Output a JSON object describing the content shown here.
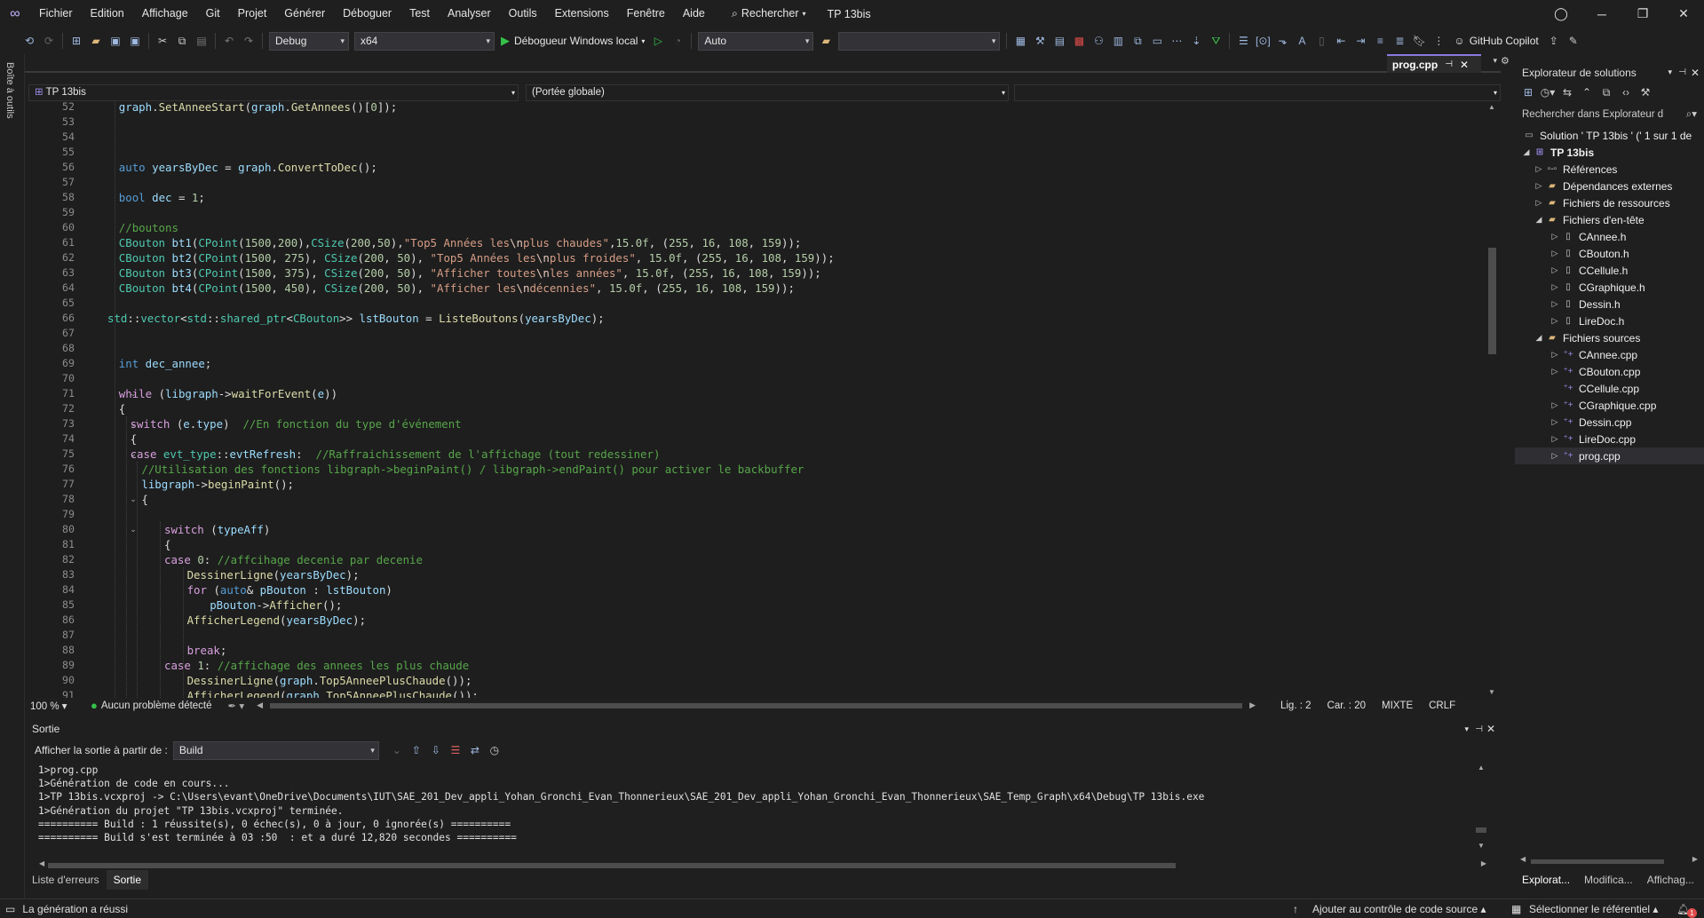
{
  "menu": [
    "Fichier",
    "Edition",
    "Affichage",
    "Git",
    "Projet",
    "Générer",
    "Déboguer",
    "Test",
    "Analyser",
    "Outils",
    "Extensions",
    "Fenêtre",
    "Aide"
  ],
  "search_label": "Rechercher",
  "solution_title": "TP 13bis",
  "toolbar": {
    "config": "Debug",
    "platform": "x64",
    "debugger": "Débogueur Windows local",
    "auto": "Auto",
    "copilot": "GitHub Copilot"
  },
  "toolbox_label": "Boîte à outils",
  "editor": {
    "tab_name": "prog.cpp",
    "nav_project": "TP 13bis",
    "nav_scope": "(Portée globale)",
    "zoom": "100 %",
    "problems": "Aucun problème détecté",
    "line": "Lig. : 2",
    "col": "Car. : 20",
    "mode": "MIXTE",
    "eol": "CRLF"
  },
  "code_lines": [
    {
      "n": "52",
      "h": "<span class=\"v\">graph</span>.<span class=\"f\">SetAnneeStart</span>(<span class=\"v\">graph</span>.<span class=\"f\">GetAnnees</span>()[<span class=\"n\">0</span>]);",
      "indent": 1
    },
    {
      "n": "53",
      "h": "",
      "indent": 0
    },
    {
      "n": "54",
      "h": "",
      "indent": 0
    },
    {
      "n": "55",
      "h": "",
      "indent": 0
    },
    {
      "n": "56",
      "h": "<span class=\"k\">auto</span> <span class=\"v\">yearsByDec</span> = <span class=\"v\">graph</span>.<span class=\"f\">ConvertToDec</span>();",
      "indent": 1
    },
    {
      "n": "57",
      "h": "",
      "indent": 0
    },
    {
      "n": "58",
      "h": "<span class=\"k\">bool</span> <span class=\"v\">dec</span> = <span class=\"n\">1</span>;",
      "indent": 1
    },
    {
      "n": "59",
      "h": "",
      "indent": 0
    },
    {
      "n": "60",
      "h": "<span class=\"c\">//boutons</span>",
      "indent": 1
    },
    {
      "n": "61",
      "h": "<span class=\"t\">CBouton</span> <span class=\"v\">bt1</span>(<span class=\"t\">CPoint</span>(<span class=\"n\">1500</span>,<span class=\"n\">200</span>),<span class=\"t\">CSize</span>(<span class=\"n\">200</span>,<span class=\"n\">50</span>),<span class=\"s\">\"Top5 Années les</span><span class=\"esc\">\\n</span><span class=\"s\">plus chaudes\"</span>,<span class=\"n\">15.0f</span>, (<span class=\"n\">255</span>, <span class=\"n\">16</span>, <span class=\"n\">108</span>, <span class=\"n\">159</span>));",
      "indent": 1
    },
    {
      "n": "62",
      "h": "<span class=\"t\">CBouton</span> <span class=\"v\">bt2</span>(<span class=\"t\">CPoint</span>(<span class=\"n\">1500</span>, <span class=\"n\">275</span>), <span class=\"t\">CSize</span>(<span class=\"n\">200</span>, <span class=\"n\">50</span>), <span class=\"s\">\"Top5 Années les</span><span class=\"esc\">\\n</span><span class=\"s\">plus froides\"</span>, <span class=\"n\">15.0f</span>, (<span class=\"n\">255</span>, <span class=\"n\">16</span>, <span class=\"n\">108</span>, <span class=\"n\">159</span>));",
      "indent": 1
    },
    {
      "n": "63",
      "h": "<span class=\"t\">CBouton</span> <span class=\"v\">bt3</span>(<span class=\"t\">CPoint</span>(<span class=\"n\">1500</span>, <span class=\"n\">375</span>), <span class=\"t\">CSize</span>(<span class=\"n\">200</span>, <span class=\"n\">50</span>), <span class=\"s\">\"Afficher toutes</span><span class=\"esc\">\\n</span><span class=\"s\">les années\"</span>, <span class=\"n\">15.0f</span>, (<span class=\"n\">255</span>, <span class=\"n\">16</span>, <span class=\"n\">108</span>, <span class=\"n\">159</span>));",
      "indent": 1
    },
    {
      "n": "64",
      "h": "<span class=\"t\">CBouton</span> <span class=\"v\">bt4</span>(<span class=\"t\">CPoint</span>(<span class=\"n\">1500</span>, <span class=\"n\">450</span>), <span class=\"t\">CSize</span>(<span class=\"n\">200</span>, <span class=\"n\">50</span>), <span class=\"s\">\"Afficher les</span><span class=\"esc\">\\n</span><span class=\"s\">décennies\"</span>, <span class=\"n\">15.0f</span>, (<span class=\"n\">255</span>, <span class=\"n\">16</span>, <span class=\"n\">108</span>, <span class=\"n\">159</span>));",
      "indent": 1
    },
    {
      "n": "65",
      "h": "",
      "indent": 0
    },
    {
      "n": "66",
      "h": "<span class=\"t\">std</span>::<span class=\"t\">vector</span>&lt;<span class=\"t\">std</span>::<span class=\"t\">shared_ptr</span>&lt;<span class=\"t\">CBouton</span>&gt;&gt; <span class=\"v\">lstBouton</span> = <span class=\"f\">ListeBoutons</span>(<span class=\"v\">yearsByDec</span>);",
      "indent": 0
    },
    {
      "n": "67",
      "h": "",
      "indent": 0
    },
    {
      "n": "68",
      "h": "",
      "indent": 0
    },
    {
      "n": "69",
      "h": "<span class=\"k\">int</span> <span class=\"v\">dec_annee</span>;",
      "indent": 1
    },
    {
      "n": "70",
      "h": "",
      "indent": 0
    },
    {
      "n": "71",
      "h": "<span class=\"kc\">while</span> (<span class=\"v\">libgraph</span>-&gt;<span class=\"f\">waitForEvent</span>(<span class=\"v\">e</span>))",
      "indent": 1
    },
    {
      "n": "72",
      "h": "{",
      "indent": 1
    },
    {
      "n": "73",
      "h": "<span class=\"kc\">switch</span> (<span class=\"v\">e</span>.<span class=\"v\">type</span>)  <span class=\"c\">//En fonction du type d'événement</span>",
      "indent": 2
    },
    {
      "n": "74",
      "h": "{",
      "indent": 2
    },
    {
      "n": "75",
      "h": "<span class=\"kc\">case</span> <span class=\"t\">evt_type</span>::<span class=\"v\">evtRefresh</span>:  <span class=\"c\">//Raffraichissement de l'affichage (tout redessiner)</span>",
      "indent": 2
    },
    {
      "n": "76",
      "h": "<span class=\"c\">//Utilisation des fonctions libgraph-&gt;beginPaint() / libgraph-&gt;endPaint() pour activer le backbuffer</span>",
      "indent": 3
    },
    {
      "n": "77",
      "h": "<span class=\"v\">libgraph</span>-&gt;<span class=\"f\">beginPaint</span>();",
      "indent": 3
    },
    {
      "n": "78",
      "h": "{",
      "indent": 3
    },
    {
      "n": "79",
      "h": "",
      "indent": 0
    },
    {
      "n": "80",
      "h": "<span class=\"kc\">switch</span> (<span class=\"v\">typeAff</span>)",
      "indent": 5
    },
    {
      "n": "81",
      "h": "{",
      "indent": 5
    },
    {
      "n": "82",
      "h": "<span class=\"kc\">case</span> <span class=\"n\">0</span>: <span class=\"c\">//affcihage decenie par decenie</span>",
      "indent": 5
    },
    {
      "n": "83",
      "h": "<span class=\"f\">DessinerLigne</span>(<span class=\"v\">yearsByDec</span>);",
      "indent": 7
    },
    {
      "n": "84",
      "h": "<span class=\"kc\">for</span> (<span class=\"k\">auto</span>&amp; <span class=\"v\">pBouton</span> : <span class=\"v\">lstBouton</span>)",
      "indent": 7
    },
    {
      "n": "85",
      "h": "<span class=\"v\">pBouton</span>-&gt;<span class=\"f\">Afficher</span>();",
      "indent": 9
    },
    {
      "n": "86",
      "h": "<span class=\"f\">AfficherLegend</span>(<span class=\"v\">yearsByDec</span>);",
      "indent": 7
    },
    {
      "n": "87",
      "h": "",
      "indent": 0
    },
    {
      "n": "88",
      "h": "<span class=\"kc\">break</span>;",
      "indent": 7
    },
    {
      "n": "89",
      "h": "<span class=\"kc\">case</span> <span class=\"n\">1</span>: <span class=\"c\">//affichage des annees les plus chaude</span>",
      "indent": 5
    },
    {
      "n": "90",
      "h": "<span class=\"f\">DessinerLigne</span>(<span class=\"v\">graph</span>.<span class=\"f\">Top5AnneePlusChaude</span>());",
      "indent": 7
    },
    {
      "n": "91",
      "h": "<span class=\"f\">AfficherLegend</span>(<span class=\"v\">graph</span>.<span class=\"f\">Top5AnneePlusChaude</span>());",
      "indent": 7
    }
  ],
  "output": {
    "title": "Sortie",
    "source_label": "Afficher la sortie à partir de :",
    "source_value": "Build",
    "lines": [
      "1>prog.cpp",
      "1>Génération de code en cours...",
      "1>TP 13bis.vcxproj -> C:\\Users\\evant\\OneDrive\\Documents\\IUT\\SAE_201_Dev_appli_Yohan_Gronchi_Evan_Thonnerieux\\SAE_201_Dev_appli_Yohan_Gronchi_Evan_Thonnerieux\\SAE_Temp_Graph\\x64\\Debug\\TP 13bis.exe",
      "1>Génération du projet \"TP 13bis.vcxproj\" terminée.",
      "========== Build : 1 réussite(s), 0 échec(s), 0 à jour, 0 ignorée(s) ==========",
      "========== Build s'est terminée à 03 :50  : et a duré 12,820 secondes =========="
    ]
  },
  "bottom_tabs": [
    "Liste d'erreurs",
    "Sortie"
  ],
  "solution_explorer": {
    "title": "Explorateur de solutions",
    "search": "Rechercher dans Explorateur d",
    "solution_node": "Solution ' TP 13bis ' (' 1 sur 1 de",
    "project": "TP 13bis",
    "nodes": [
      {
        "label": "Références",
        "level": 2,
        "exp": "▷",
        "icon": "references-icon"
      },
      {
        "label": "Dépendances externes",
        "level": 2,
        "exp": "▷",
        "icon": "folder-icon"
      },
      {
        "label": "Fichiers de ressources",
        "level": 2,
        "exp": "▷",
        "icon": "folder-icon"
      },
      {
        "label": "Fichiers d'en-tête",
        "level": 2,
        "exp": "◢",
        "icon": "folder-icon"
      },
      {
        "label": "CAnnee.h",
        "level": 3,
        "exp": "▷",
        "icon": "header-file-icon"
      },
      {
        "label": "CBouton.h",
        "level": 3,
        "exp": "▷",
        "icon": "header-file-icon"
      },
      {
        "label": "CCellule.h",
        "level": 3,
        "exp": "▷",
        "icon": "header-file-icon"
      },
      {
        "label": "CGraphique.h",
        "level": 3,
        "exp": "▷",
        "icon": "header-file-icon"
      },
      {
        "label": "Dessin.h",
        "level": 3,
        "exp": "▷",
        "icon": "header-file-icon"
      },
      {
        "label": "LireDoc.h",
        "level": 3,
        "exp": "▷",
        "icon": "header-file-icon"
      },
      {
        "label": "Fichiers sources",
        "level": 2,
        "exp": "◢",
        "icon": "folder-icon"
      },
      {
        "label": "CAnnee.cpp",
        "level": 3,
        "exp": "▷",
        "icon": "cpp-file-icon"
      },
      {
        "label": "CBouton.cpp",
        "level": 3,
        "exp": "▷",
        "icon": "cpp-file-icon"
      },
      {
        "label": "CCellule.cpp",
        "level": 3,
        "exp": "",
        "icon": "cpp-file-icon"
      },
      {
        "label": "CGraphique.cpp",
        "level": 3,
        "exp": "▷",
        "icon": "cpp-file-icon"
      },
      {
        "label": "Dessin.cpp",
        "level": 3,
        "exp": "▷",
        "icon": "cpp-file-icon"
      },
      {
        "label": "LireDoc.cpp",
        "level": 3,
        "exp": "▷",
        "icon": "cpp-file-icon"
      },
      {
        "label": "prog.cpp",
        "level": 3,
        "exp": "▷",
        "icon": "cpp-file-icon",
        "selected": true
      }
    ],
    "tabs": [
      "Explorat...",
      "Modifica...",
      "Affichag..."
    ]
  },
  "status": {
    "left": "La génération a réussi",
    "source_control": "Ajouter au contrôle de code source",
    "repo": "Sélectionner le référentiel",
    "notifications": "1"
  },
  "colors": {
    "accent": "#8a7be0",
    "bg": "#1f1f1f",
    "editor_bg": "#1e1e1e",
    "success": "#35c24a"
  }
}
